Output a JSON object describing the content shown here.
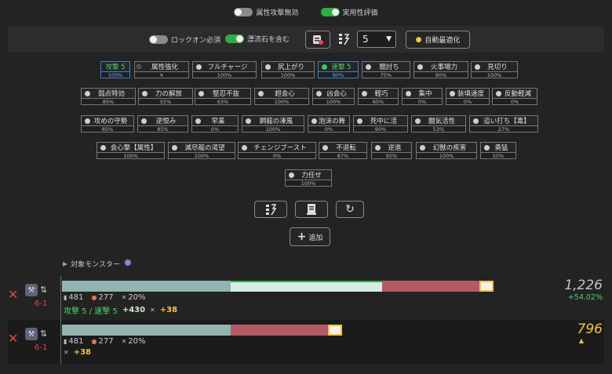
{
  "top_toggles": [
    {
      "label": "属性攻撃無効",
      "on": false
    },
    {
      "label": "実用性評価",
      "on": true
    }
  ],
  "options": {
    "lockon_label": "ロックオン必須",
    "lockon_on": false,
    "drift_label": "漂流石を含む",
    "drift_on": true,
    "slot_value": "5",
    "auto_label": "自動最適化"
  },
  "skills": [
    {
      "name": "攻撃 5",
      "level": "100%",
      "active": true,
      "marker": "none"
    },
    {
      "name": "属性強化",
      "level": "✕",
      "marker": "ban"
    },
    {
      "name": "フルチャージ",
      "level": "100%",
      "marker": "dot"
    },
    {
      "name": "尻上がり",
      "level": "100%",
      "marker": "dot"
    },
    {
      "name": "速撃 5",
      "level": "90%",
      "active": true,
      "marker": "dot-on"
    },
    {
      "name": "闇討ち",
      "level": "75%",
      "marker": "dot"
    },
    {
      "name": "火事場力",
      "level": "90%",
      "marker": "dot"
    },
    {
      "name": "見切り",
      "level": "100%",
      "marker": "dot"
    },
    {
      "name": "弱点特効",
      "level": "85%",
      "marker": "dot"
    },
    {
      "name": "力の解放",
      "level": "55%",
      "marker": "dot"
    },
    {
      "name": "堅忍不抜",
      "level": "63%",
      "marker": "dot"
    },
    {
      "name": "超会心",
      "level": "100%",
      "marker": "dot"
    },
    {
      "name": "凶会心",
      "level": "100%",
      "marker": "dot"
    },
    {
      "name": "軽巧",
      "level": "60%",
      "marker": "dot"
    },
    {
      "name": "集中",
      "level": "0%",
      "marker": "dot"
    },
    {
      "name": "装填速度",
      "level": "0%",
      "marker": "dot"
    },
    {
      "name": "反動軽減",
      "level": "0%",
      "marker": "dot"
    },
    {
      "name": "攻めの守勢",
      "level": "85%",
      "marker": "dot"
    },
    {
      "name": "逆恨み",
      "level": "85%",
      "marker": "dot"
    },
    {
      "name": "早業",
      "level": "0%",
      "marker": "dot"
    },
    {
      "name": "鋼龍の凍風",
      "level": "100%",
      "marker": "dot"
    },
    {
      "name": "泡沫の舞",
      "level": "0%",
      "marker": "dot"
    },
    {
      "name": "死中に活",
      "level": "90%",
      "marker": "dot"
    },
    {
      "name": "闘気活性",
      "level": "53%",
      "marker": "dot"
    },
    {
      "name": "追い打ち【毒】",
      "level": "27%",
      "marker": "dot"
    },
    {
      "name": "会心撃【属性】",
      "level": "100%",
      "marker": "dot"
    },
    {
      "name": "滅尽龍の渇望",
      "level": "100%",
      "marker": "dot"
    },
    {
      "name": "チェンジブースト",
      "level": "0%",
      "marker": "dot"
    },
    {
      "name": "不退転",
      "level": "87%",
      "marker": "dot"
    },
    {
      "name": "逆進",
      "level": "95%",
      "marker": "dot"
    },
    {
      "name": "幻獣の疾害",
      "level": "100%",
      "marker": "dot"
    },
    {
      "name": "勇猛",
      "level": "50%",
      "marker": "dot"
    },
    {
      "name": "力任せ",
      "level": "100%",
      "marker": "dot"
    }
  ],
  "add_label": "追加",
  "target_label": "対象モンスター",
  "results": [
    {
      "level": "6-1",
      "attack": "481",
      "fire": "277",
      "affinity": "20%",
      "skills_text": "攻撃 5 / 速撃 5",
      "bonus1": "+430",
      "bonus2": "+38",
      "score": "1,226",
      "pct": "+54.02%"
    },
    {
      "level": "6-1",
      "attack": "481",
      "fire": "277",
      "affinity": "20%",
      "bonus2": "+38",
      "score": "796"
    }
  ],
  "colors": {
    "accent_green": "#2fae45",
    "bar_teal": "#92b3ae",
    "bar_light": "#d6ede6",
    "bar_red": "#b25a63",
    "score_yellow": "#f2c24b",
    "remove_red": "#e0454c"
  }
}
